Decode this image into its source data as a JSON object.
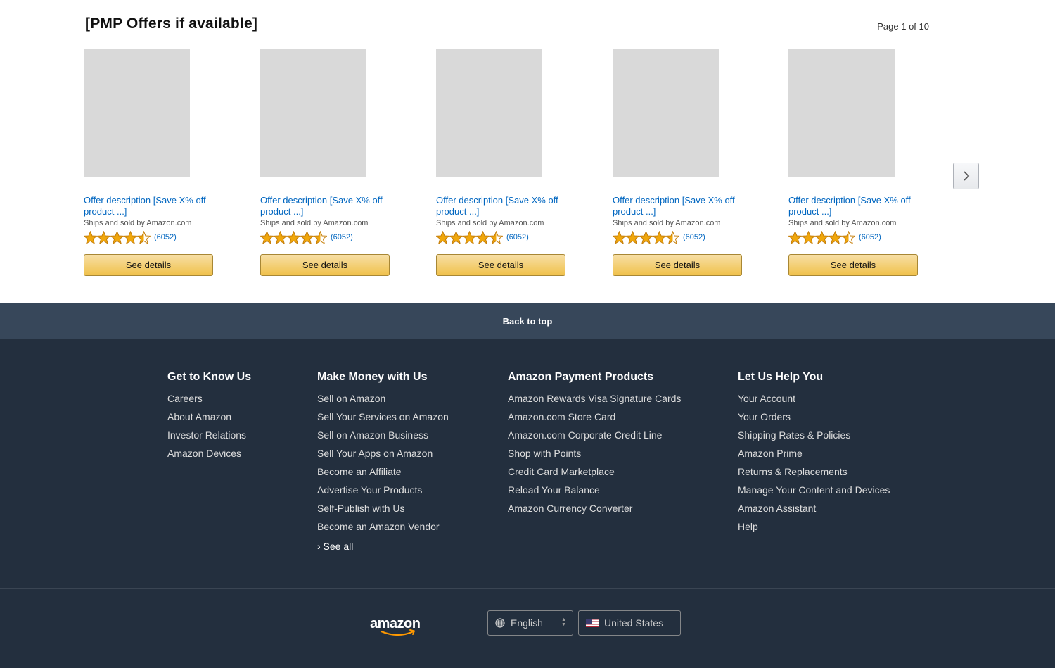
{
  "offers": {
    "title": "[PMP Offers if available]",
    "page_indicator": "Page 1 of 10",
    "cards": [
      {
        "description_line1": "Offer description [Save X% off",
        "description_line2": "product ...]",
        "seller": "Ships and sold by Amazon.com",
        "rating": 4.5,
        "rating_count": "(6052)",
        "button": "See details"
      },
      {
        "description_line1": "Offer description [Save X% off",
        "description_line2": "product ...]",
        "seller": "Ships and sold by Amazon.com",
        "rating": 4.5,
        "rating_count": "(6052)",
        "button": "See details"
      },
      {
        "description_line1": "Offer description [Save X% off",
        "description_line2": "product ...]",
        "seller": "Ships and sold by Amazon.com",
        "rating": 4.5,
        "rating_count": "(6052)",
        "button": "See details"
      },
      {
        "description_line1": "Offer description [Save X% off",
        "description_line2": "product ...]",
        "seller": "Ships and sold by Amazon.com",
        "rating": 4.5,
        "rating_count": "(6052)",
        "button": "See details"
      },
      {
        "description_line1": "Offer description [Save X% off",
        "description_line2": "product ...]",
        "seller": "Ships and sold by Amazon.com",
        "rating": 4.5,
        "rating_count": "(6052)",
        "button": "See details"
      }
    ],
    "next_icon": "chevron-right-icon"
  },
  "footer": {
    "back_to_top": "Back to top",
    "columns": [
      {
        "title": "Get to Know Us",
        "links": [
          "Careers",
          "About Amazon",
          "Investor Relations",
          "Amazon Devices"
        ]
      },
      {
        "title": "Make Money with Us",
        "links": [
          "Sell on Amazon",
          "Sell Your Services on Amazon",
          "Sell on Amazon Business",
          "Sell Your Apps on Amazon",
          "Become an Affiliate",
          "Advertise Your Products",
          "Self-Publish with Us",
          "Become an Amazon Vendor"
        ],
        "see_all": "› See all"
      },
      {
        "title": "Amazon Payment Products",
        "links": [
          "Amazon Rewards Visa Signature Cards",
          "Amazon.com Store Card",
          "Amazon.com Corporate Credit Line",
          "Shop with Points",
          "Credit Card Marketplace",
          "Reload Your Balance",
          "Amazon Currency Converter"
        ]
      },
      {
        "title": "Let Us Help You",
        "links": [
          "Your Account",
          "Your Orders",
          "Shipping Rates & Policies",
          "Amazon Prime",
          "Returns & Replacements",
          "Manage Your Content and Devices",
          "Amazon Assistant",
          "Help"
        ]
      }
    ],
    "logo": "amazon",
    "language": "English",
    "country": "United States"
  },
  "colors": {
    "link": "#0066c0",
    "star": "#f0a70c",
    "button": "#f0c14b",
    "footer_bg": "#232f3e",
    "back_to_top_bg": "#37475a"
  }
}
